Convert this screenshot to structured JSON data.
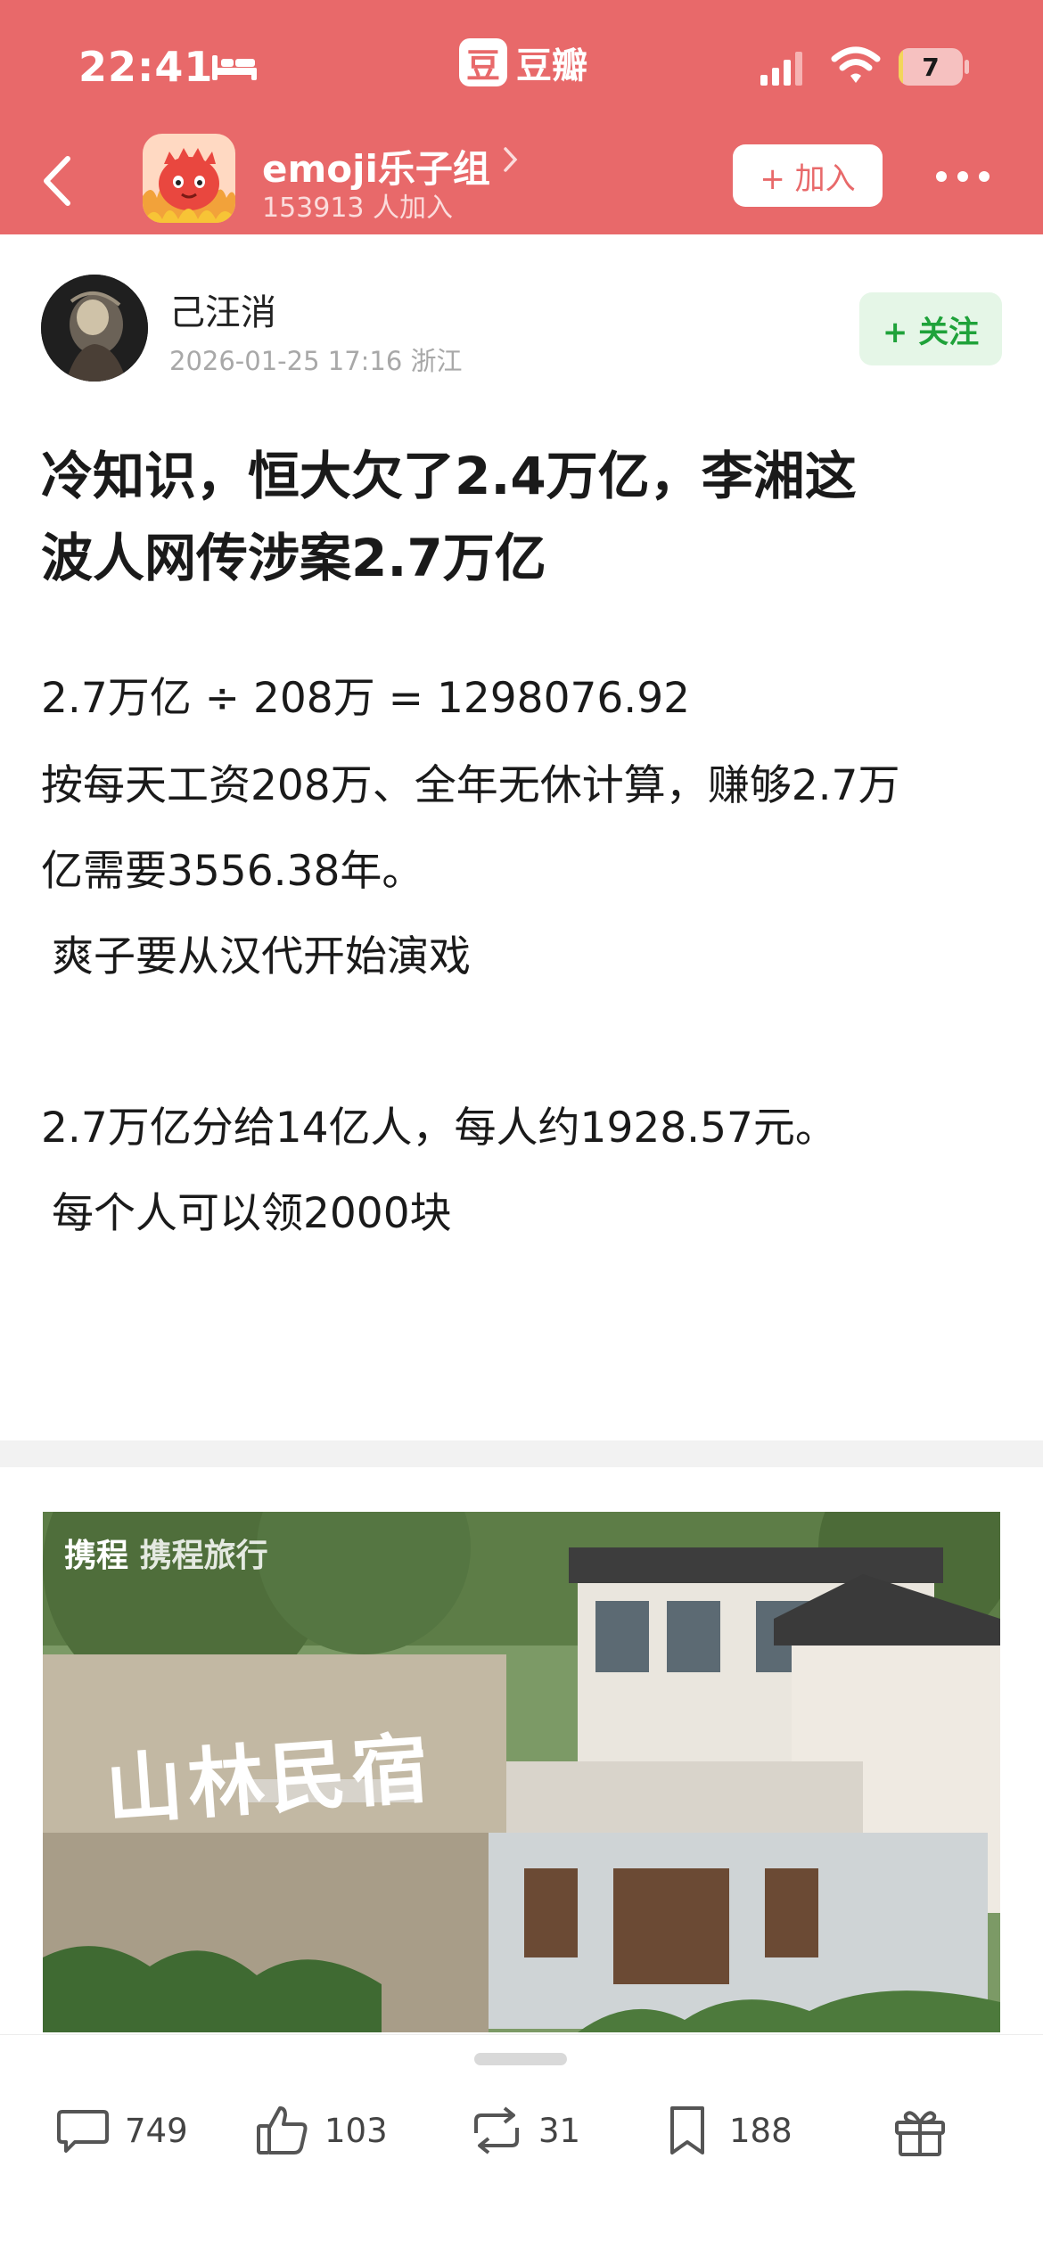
{
  "status_bar": {
    "time": "22:41",
    "app_logo": "豆",
    "app_name": "豆瓣",
    "battery": "7",
    "battery_level": 0.07
  },
  "nav": {
    "group_name": "emoji乐子组",
    "group_members": "153913 人加入",
    "join_label": "+ 加入"
  },
  "post": {
    "author": "己汪消",
    "meta": "2026-01-25 17:16  浙江",
    "follow_label": "+ 关注",
    "title_line1": "冷知识，恒大欠了2.4万亿，李湘这",
    "title_line2": "波人网传涉案2.7万亿",
    "lines": [
      "2.7万亿 ÷ 208万 = 1298076.92",
      "按每天工资208万、全年无休计算，赚够2.7万",
      "亿需要3556.38年。",
      "爽子要从汉代开始演戏",
      "2.7万亿分给14亿人，每人约1928.57元。",
      "每个人可以领2000块"
    ]
  },
  "ad": {
    "brand": "携程",
    "brand_logo": "携程旅行",
    "title": "山林民宿"
  },
  "actions": {
    "comments": "749",
    "likes": "103",
    "reshares": "31",
    "collects": "188"
  },
  "colors": {
    "header": "#e8696a",
    "follow_green": "#1fa23a"
  }
}
